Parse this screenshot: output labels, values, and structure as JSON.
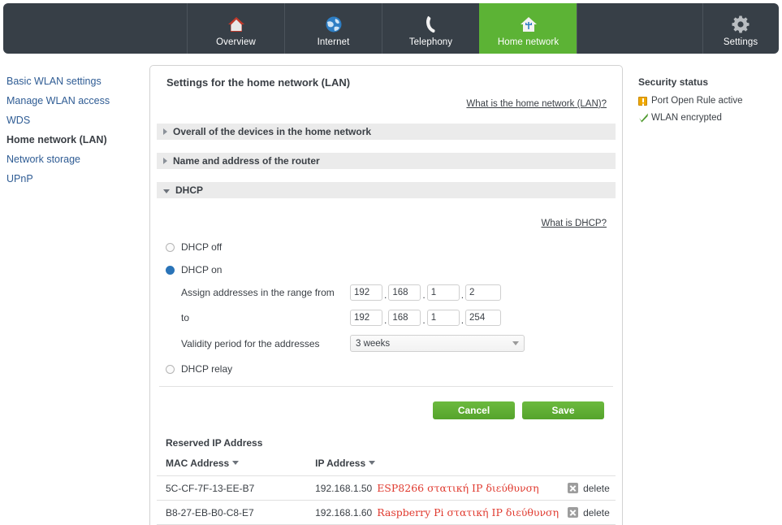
{
  "topnav": {
    "items": [
      {
        "label": "Overview",
        "icon": "house-red-icon",
        "active": false
      },
      {
        "label": "Internet",
        "icon": "globe-icon",
        "active": false
      },
      {
        "label": "Telephony",
        "icon": "phone-handset-icon",
        "active": false
      },
      {
        "label": "Home network",
        "icon": "house-network-icon",
        "active": true
      },
      {
        "label": "Settings",
        "icon": "gear-icon",
        "active": false
      }
    ],
    "active_color": "#5cb335",
    "bar_color": "#373f47"
  },
  "sidebar": {
    "items": [
      {
        "label": "Basic WLAN settings",
        "active": false
      },
      {
        "label": "Manage WLAN access",
        "active": false
      },
      {
        "label": "WDS",
        "active": false
      },
      {
        "label": "Home network (LAN)",
        "active": true
      },
      {
        "label": "Network storage",
        "active": false
      },
      {
        "label": "UPnP",
        "active": false
      }
    ],
    "link_color": "#2f5c94"
  },
  "panel": {
    "title": "Settings for the home network (LAN)",
    "help_link": "What is the home network (LAN)?",
    "sections": [
      {
        "label": "Overall of the devices in the home network",
        "expanded": false
      },
      {
        "label": "Name and address of the router",
        "expanded": false
      },
      {
        "label": "DHCP",
        "expanded": true
      }
    ]
  },
  "dhcp": {
    "help_link": "What is DHCP?",
    "options": [
      {
        "label": "DHCP off",
        "selected": false
      },
      {
        "label": "DHCP on",
        "selected": true
      },
      {
        "label": "DHCP relay",
        "selected": false
      }
    ],
    "range_from_label": "Assign addresses in the range from",
    "range_from": [
      "192",
      "168",
      "1",
      "2"
    ],
    "range_to_label": "to",
    "range_to": [
      "192",
      "168",
      "1",
      "254"
    ],
    "validity_label": "Validity period for the addresses",
    "validity_value": "3 weeks",
    "buttons": {
      "cancel": "Cancel",
      "save": "Save"
    },
    "button_color": "#5cb335"
  },
  "reserved": {
    "title": "Reserved IP Address",
    "columns": [
      "MAC Address",
      "IP Address"
    ],
    "delete_label": "delete",
    "note_color": "#e03a2f",
    "rows": [
      {
        "mac": "5C-CF-7F-13-EE-B7",
        "ip": "192.168.1.50",
        "note": "ESP8266 στατική IP διεύθυνση",
        "delete": "delete"
      },
      {
        "mac": "B8-27-EB-B0-C8-E7",
        "ip": "192.168.1.60",
        "note": "Raspberry Pi στατική IP διεύθυνση",
        "delete": "delete"
      }
    ]
  },
  "security": {
    "title": "Security status",
    "items": [
      {
        "label": "Port Open Rule active",
        "icon": "warning-icon",
        "color": "#f0a800"
      },
      {
        "label": "WLAN encrypted",
        "icon": "check-icon",
        "color": "#4f9a2f"
      }
    ]
  }
}
